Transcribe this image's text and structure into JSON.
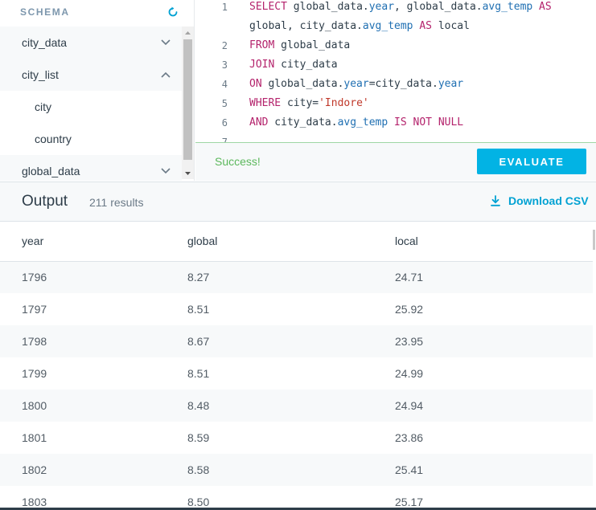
{
  "schema": {
    "title": "SCHEMA",
    "items": [
      {
        "label": "city_data",
        "kind": "table",
        "expanded": false
      },
      {
        "label": "city_list",
        "kind": "table",
        "expanded": true
      },
      {
        "label": "city",
        "kind": "column"
      },
      {
        "label": "country",
        "kind": "column"
      },
      {
        "label": "global_data",
        "kind": "table",
        "expanded": false
      }
    ]
  },
  "editor": {
    "lines": [
      {
        "n": "1",
        "tokens": [
          {
            "t": "SELECT ",
            "c": "kw"
          },
          {
            "t": "global_data.",
            "c": ""
          },
          {
            "t": "year",
            "c": "prop"
          },
          {
            "t": ", global_data.",
            "c": ""
          },
          {
            "t": "avg_temp",
            "c": "prop"
          },
          {
            "t": " AS",
            "c": "kw"
          }
        ]
      },
      {
        "n": "",
        "tokens": [
          {
            "t": "global, city_data.",
            "c": ""
          },
          {
            "t": "avg_temp",
            "c": "prop"
          },
          {
            "t": " AS",
            "c": "kw"
          },
          {
            "t": " local",
            "c": ""
          }
        ]
      },
      {
        "n": "2",
        "tokens": [
          {
            "t": "FROM",
            "c": "kw"
          },
          {
            "t": " global_data",
            "c": ""
          }
        ]
      },
      {
        "n": "3",
        "tokens": [
          {
            "t": "JOIN",
            "c": "kw"
          },
          {
            "t": " city_data",
            "c": ""
          }
        ]
      },
      {
        "n": "4",
        "tokens": [
          {
            "t": "ON",
            "c": "kw"
          },
          {
            "t": " global_data.",
            "c": ""
          },
          {
            "t": "year",
            "c": "prop"
          },
          {
            "t": "=city_data.",
            "c": ""
          },
          {
            "t": "year",
            "c": "prop"
          }
        ]
      },
      {
        "n": "5",
        "tokens": [
          {
            "t": "WHERE",
            "c": "kw"
          },
          {
            "t": " city=",
            "c": ""
          },
          {
            "t": "'Indore'",
            "c": "str"
          }
        ]
      },
      {
        "n": "6",
        "tokens": [
          {
            "t": "AND",
            "c": "kw"
          },
          {
            "t": " city_data.",
            "c": ""
          },
          {
            "t": "avg_temp",
            "c": "prop"
          },
          {
            "t": " IS NOT NULL",
            "c": "kw"
          }
        ]
      },
      {
        "n": "7",
        "tokens": []
      }
    ],
    "status": "Success!",
    "evaluate_label": "EVALUATE"
  },
  "output": {
    "title": "Output",
    "count": "211 results",
    "download_label": "Download CSV",
    "columns": [
      "year",
      "global",
      "local"
    ],
    "rows": [
      [
        "1796",
        "8.27",
        "24.71"
      ],
      [
        "1797",
        "8.51",
        "25.92"
      ],
      [
        "1798",
        "8.67",
        "23.95"
      ],
      [
        "1799",
        "8.51",
        "24.99"
      ],
      [
        "1800",
        "8.48",
        "24.94"
      ],
      [
        "1801",
        "8.59",
        "23.86"
      ],
      [
        "1802",
        "8.58",
        "25.41"
      ],
      [
        "1803",
        "8.50",
        "25.17"
      ]
    ]
  },
  "colors": {
    "accent": "#02b3e4",
    "success": "#5cb85c",
    "keyword": "#b4236c",
    "property": "#1f6fb2",
    "string": "#c0392b"
  },
  "icons": {
    "refresh": "refresh-icon",
    "expand": "chevron-down-icon",
    "collapse": "chevron-up-icon",
    "download": "download-icon"
  }
}
